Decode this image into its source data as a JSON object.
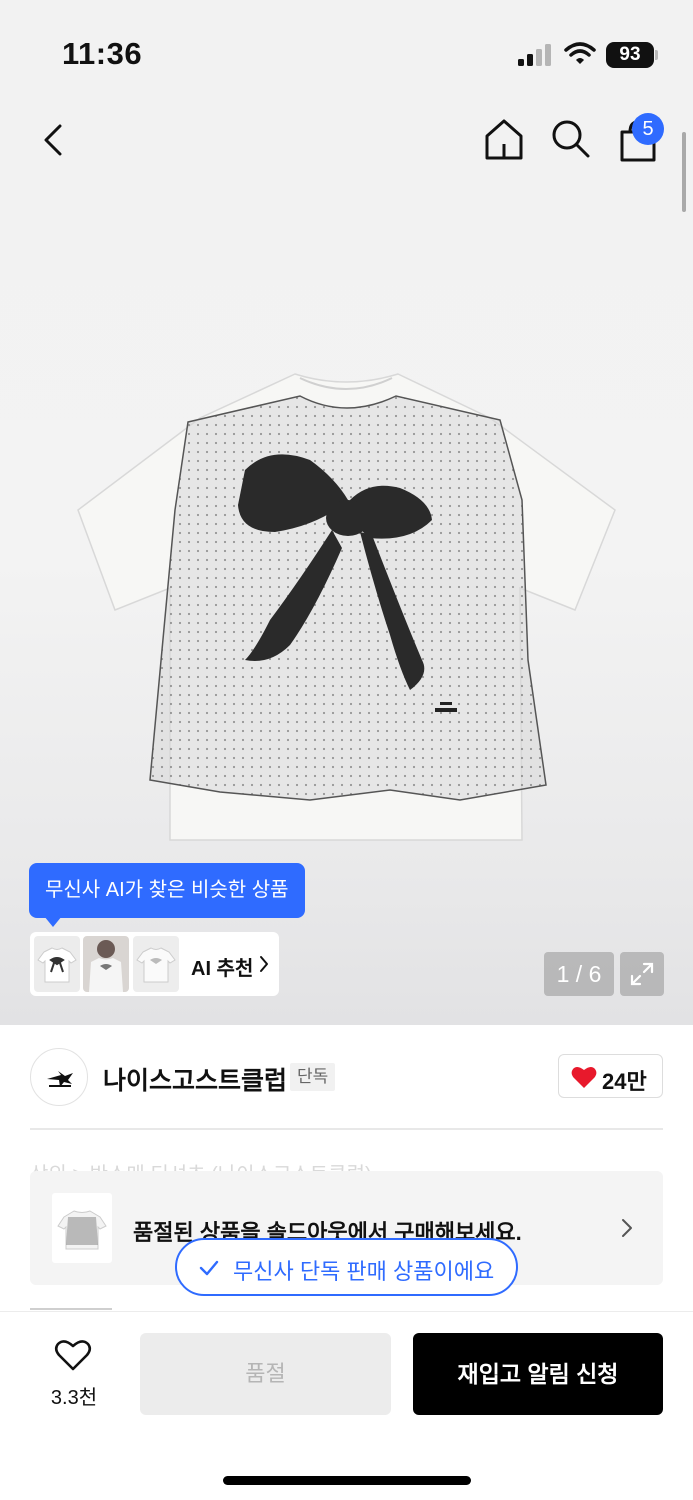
{
  "status_bar": {
    "time": "11:36",
    "battery": "93",
    "icons": [
      "signal-icon",
      "wifi-icon",
      "battery-icon"
    ]
  },
  "header": {
    "icons": [
      "chevron-left-icon",
      "home-icon",
      "search-icon",
      "shopping-bag-icon"
    ],
    "cart_badge": "5"
  },
  "gallery": {
    "ai_tooltip": "무신사 AI가 찾은 비슷한 상품",
    "ai_recommend_label": "AI 추천",
    "page_counter": "1 / 6",
    "expand_icon": "expand-icon"
  },
  "brand": {
    "name": "나이스고스트클럽",
    "badge": "단독",
    "likes": "24만"
  },
  "behind_text": "상의 > 반소매 티셔츠 (나이스고스트클럽)",
  "soldout_banner": {
    "text": "품절된 상품을 솔드아웃에서 구매해보세요."
  },
  "exclusive_pill": {
    "text": "무신사 단독 판매 상품이에요"
  },
  "bottom_bar": {
    "wish_count": "3.3천",
    "soldout_label": "품절",
    "restock_label": "재입고 알림 신청"
  },
  "colors": {
    "accent": "#2f6bff",
    "like_red": "#e8192c",
    "button_black": "#000000"
  }
}
